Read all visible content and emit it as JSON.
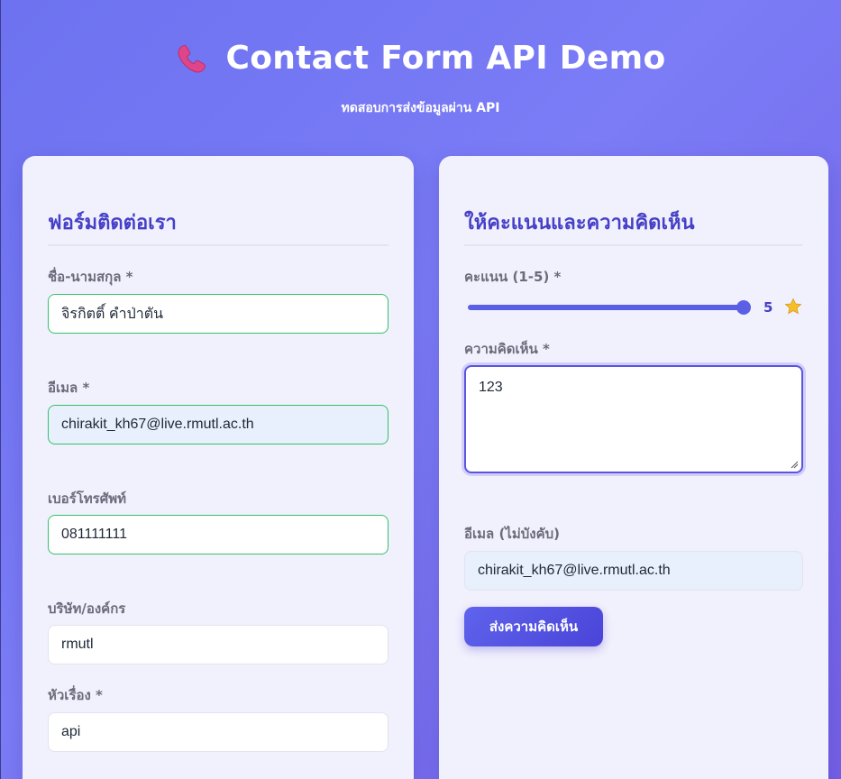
{
  "header": {
    "title": "Contact Form API Demo",
    "subtitle": "ทดสอบการส่งข้อมูลผ่าน API",
    "icon": "phone-icon"
  },
  "contact_form": {
    "title": "ฟอร์มติดต่อเรา",
    "fields": {
      "name": {
        "label": "ชื่อ-นามสกุล *",
        "value": "จิรกิตติ์ คำป่าตัน"
      },
      "email": {
        "label": "อีเมล *",
        "value": "chirakit_kh67@live.rmutl.ac.th"
      },
      "phone": {
        "label": "เบอร์โทรศัพท์",
        "value": "081111111"
      },
      "company": {
        "label": "บริษัท/องค์กร",
        "value": "rmutl"
      },
      "subject": {
        "label": "หัวเรื่อง *",
        "value": "api"
      }
    }
  },
  "feedback_form": {
    "title": "ให้คะแนนและความคิดเห็น",
    "rating": {
      "label": "คะแนน (1-5) *",
      "value": "5",
      "min": 1,
      "max": 5,
      "current": 5
    },
    "comment": {
      "label": "ความคิดเห็น *",
      "value": "123"
    },
    "email": {
      "label": "อีเมล (ไม่บังคับ)",
      "value": "chirakit_kh67@live.rmutl.ac.th"
    },
    "submit_label": "ส่งความคิดเห็น"
  },
  "colors": {
    "accent": "#4540c7",
    "valid_border": "#34c266",
    "background_gradient_start": "#6d72f0",
    "background_gradient_end": "#7460e6"
  }
}
